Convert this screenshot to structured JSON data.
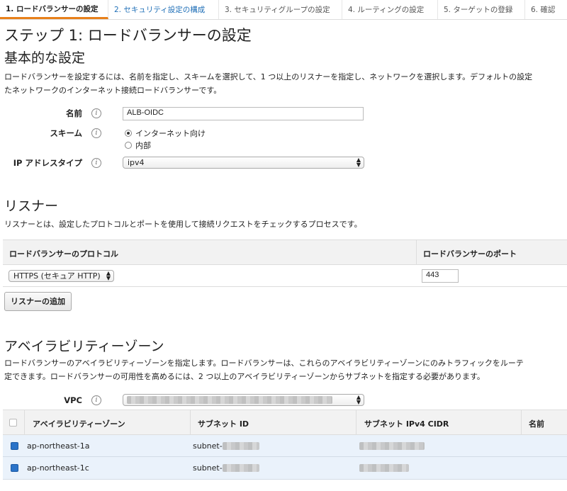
{
  "steps": [
    {
      "label": "1. ロードバランサーの設定"
    },
    {
      "label": "2. セキュリティ設定の構成"
    },
    {
      "label": "3. セキュリティグループの設定"
    },
    {
      "label": "4. ルーティングの設定"
    },
    {
      "label": "5. ターゲットの登録"
    },
    {
      "label": "6. 確認"
    }
  ],
  "page_title": "ステップ 1: ロードバランサーの設定",
  "basic": {
    "heading": "基本的な設定",
    "desc1": "ロードバランサーを設定するには、名前を指定し、スキームを選択して、1 つ以上のリスナーを指定し、ネットワークを選択します。デフォルトの設定",
    "desc2": "たネットワークのインターネット接続ロードバランサーです。",
    "name_label": "名前",
    "name_value": "ALB-OIDC",
    "scheme_label": "スキーム",
    "scheme_options": [
      "インターネット向け",
      "内部"
    ],
    "ip_label": "IP アドレスタイプ",
    "ip_value": "ipv4"
  },
  "listeners": {
    "heading": "リスナー",
    "desc": "リスナーとは、設定したプロトコルとポートを使用して接続リクエストをチェックするプロセスです。",
    "col_protocol": "ロードバランサーのプロトコル",
    "col_port": "ロードバランサーのポート",
    "protocol_value": "HTTPS (セキュア HTTP)",
    "port_value": "443",
    "add_button": "リスナーの追加"
  },
  "az": {
    "heading": "アベイラビリティーゾーン",
    "desc1": "ロードバランサーのアベイラビリティーゾーンを指定します。ロードバランサーは、これらのアベイラビリティーゾーンにのみトラフィックをルーテ",
    "desc2": "定できます。ロードバランサーの可用性を高めるには、2 つ以上のアベイラビリティーゾーンからサブネットを指定する必要があります。",
    "vpc_label": "VPC",
    "col_zone": "アベイラビリティーゾーン",
    "col_subnet": "サブネット ID",
    "col_cidr": "サブネット IPv4 CIDR",
    "col_name": "名前",
    "rows": [
      {
        "zone": "ap-northeast-1a",
        "subnet": "subnet-"
      },
      {
        "zone": "ap-northeast-1c",
        "subnet": "subnet-"
      }
    ]
  },
  "colors": {
    "accent": "#e8801a",
    "link": "#1f6fb7",
    "checkbox": "#2a73c8",
    "row_bg": "#eaf2fb"
  }
}
